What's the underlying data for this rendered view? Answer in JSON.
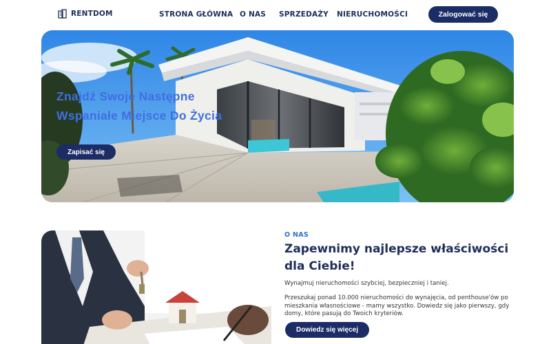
{
  "brand": {
    "name": "RENTDOM",
    "icon": "building-icon"
  },
  "nav": {
    "items": [
      {
        "label": "STRONA GŁÓWNA"
      },
      {
        "label": "O NAS"
      },
      {
        "label": "SPRZEDAŻY"
      },
      {
        "label": "NIERUCHOMOŚCI"
      }
    ],
    "login_label": "Zalogować się"
  },
  "hero": {
    "title": "Znajdź Swoje Następne Wspaniałe Miejsce Do Życia",
    "cta_label": "Zapisać się",
    "image": "modern-house-with-pool-photo"
  },
  "about": {
    "kicker": "O NAS",
    "title": "Zapewnimy najlepsze właściwości dla Ciebie!",
    "paragraph1": "Wynajmuj nieruchomości szybciej, bezpieczniej i taniej.",
    "paragraph2": "Przeszukaj ponad 10.000 nieruchomości do wynajęcia, od penthouse'ów po mieszkania własnościowe - mamy wszystko. Dowiedz się jako pierwszy, gdy domy, które pasują do Twoich kryteriów.",
    "cta_label": "Dowiedz się więcej",
    "image": "handing-over-keys-photo"
  },
  "colors": {
    "primary": "#1b2c66",
    "accent": "#3f6fe0",
    "text": "#1e2d5a"
  }
}
